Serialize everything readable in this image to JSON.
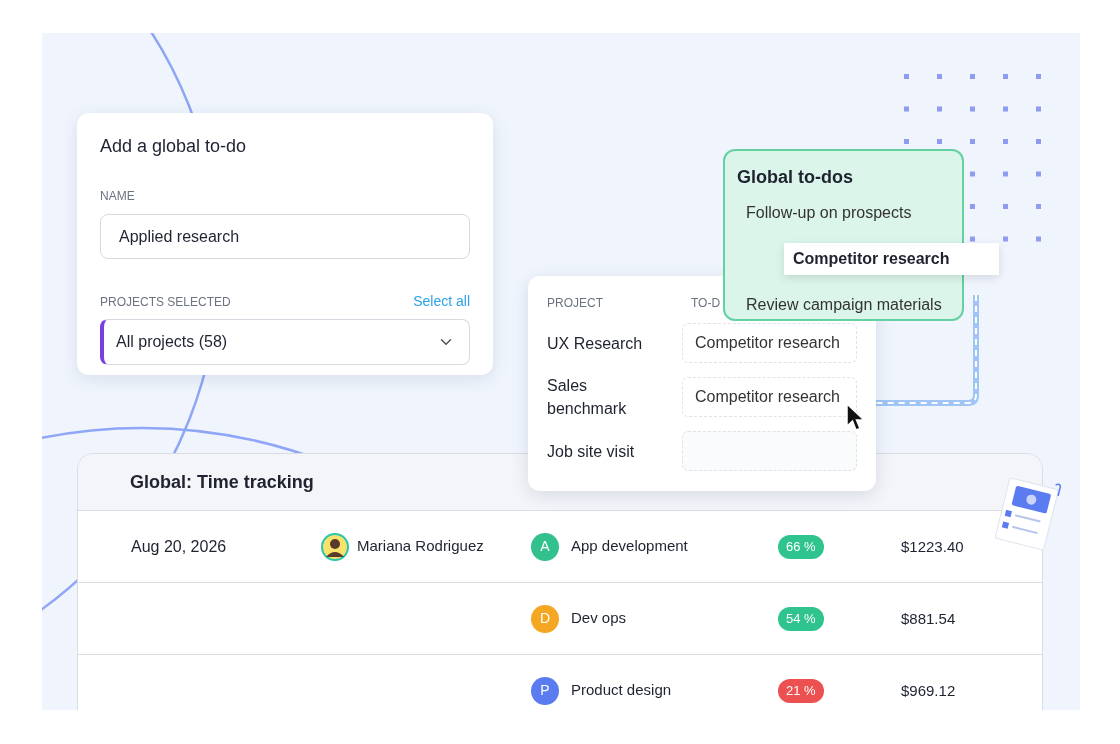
{
  "add_todo": {
    "title": "Add a global to-do",
    "name_label": "NAME",
    "name_value": "Applied research",
    "projects_label": "PROJECTS SELECTED",
    "select_all": "Select all",
    "projects_value": "All projects (58)"
  },
  "assign": {
    "columns": [
      "PROJECT",
      "TO-D"
    ],
    "rows": [
      {
        "project": "UX Research",
        "todo": "Competitor research"
      },
      {
        "project": "Sales benchmark",
        "todo": "Competitor research"
      },
      {
        "project": "Job site visit"
      }
    ]
  },
  "global_todos": {
    "title": "Global to-dos",
    "items": [
      {
        "kind": "item",
        "text": "Follow-up on prospects"
      },
      {
        "kind": "dragged",
        "text": "Competitor research"
      },
      {
        "kind": "item",
        "text": "Review campaign materials"
      }
    ]
  },
  "time_tracking": {
    "title": "Global: Time tracking",
    "rows": [
      {
        "date": "Aug 20, 2026",
        "person": "Mariana Rodriguez",
        "project": {
          "initial": "A",
          "name": "App development",
          "color": "#32c08c"
        },
        "share": {
          "text": "66 %",
          "color": "#2fc48d"
        },
        "amount": "$1223.40"
      },
      {
        "project": {
          "initial": "D",
          "name": "Dev ops",
          "color": "#f5a623"
        },
        "share": {
          "text": "54 %",
          "color": "#2fc48d"
        },
        "amount": "$881.54"
      },
      {
        "project": {
          "initial": "P",
          "name": "Product design",
          "color": "#5b7bf0"
        },
        "share": {
          "text": "21 %",
          "color": "#ec5050"
        },
        "amount": "$969.12"
      }
    ]
  }
}
